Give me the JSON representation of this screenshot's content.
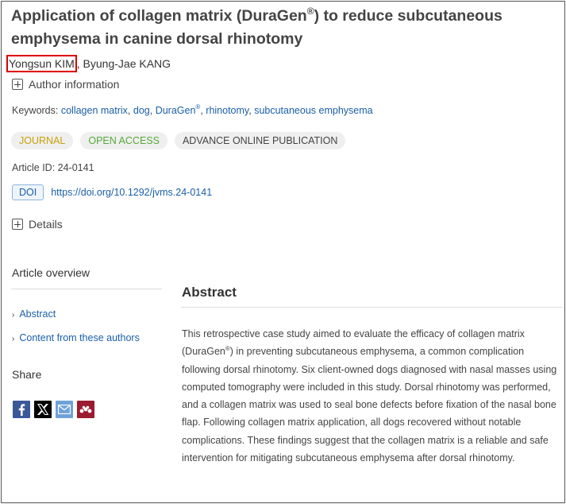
{
  "article": {
    "title_part1": "Application of collagen matrix (DuraGen",
    "title_reg": "®",
    "title_part2": ") to reduce subcutaneous emphysema in canine dorsal rhinotomy",
    "authors": [
      {
        "name": "Yongsun KIM"
      },
      {
        "name": "Byung-Jae KANG"
      }
    ],
    "author_separator": ",",
    "author_info_label": "Author information",
    "keywords_label": "Keywords:",
    "keywords": [
      {
        "text": "collagen matrix"
      },
      {
        "text": "dog"
      },
      {
        "text": "DuraGen",
        "sup": "®"
      },
      {
        "text": "rhinotomy"
      },
      {
        "text": "subcutaneous emphysema"
      }
    ],
    "badges": [
      {
        "label": "JOURNAL",
        "color": "#c8a20b"
      },
      {
        "label": "OPEN ACCESS",
        "color": "#56a83a"
      },
      {
        "label": "ADVANCE ONLINE PUBLICATION",
        "color": "#444444"
      }
    ],
    "article_id": "Article ID: 24-0141",
    "doi_label": "DOI",
    "doi_link": "https://doi.org/10.1292/jvms.24-0141",
    "details_label": "Details"
  },
  "sidebar": {
    "overview_title": "Article overview",
    "nav": [
      {
        "label": "Abstract"
      },
      {
        "label": "Content from these authors"
      }
    ],
    "share_title": "Share",
    "share_icons": [
      "facebook-icon",
      "x-icon",
      "email-icon",
      "mendeley-icon"
    ]
  },
  "abstract": {
    "title": "Abstract",
    "text_part1": "This retrospective case study aimed to evaluate the efficacy of collagen matrix (DuraGen",
    "text_reg": "®",
    "text_part2": ") in preventing subcutaneous emphysema, a common complication following dorsal rhinotomy. Six client-owned dogs diagnosed with nasal masses using computed tomography were included in this study. Dorsal rhinotomy was performed, and a collagen matrix was used to seal bone defects before fixation of the nasal bone flap. Following collagen matrix application, all dogs recovered without notable complications. These findings suggest that the collagen matrix is a reliable and safe intervention for mitigating subcutaneous emphysema after dorsal rhinotomy."
  },
  "colors": {
    "link": "#1a5fa8",
    "highlight_border": "#dd0000"
  }
}
